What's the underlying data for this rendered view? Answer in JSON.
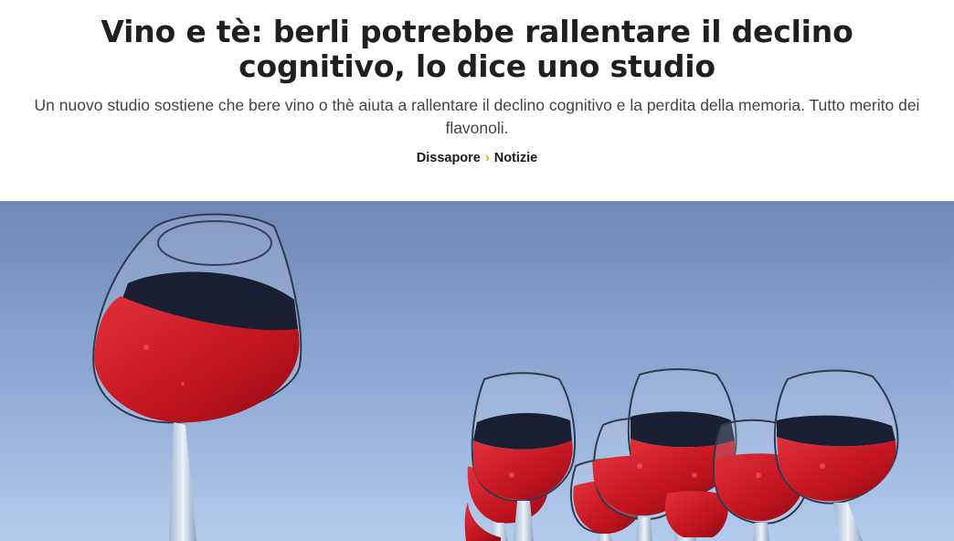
{
  "article": {
    "title": "Vino e tè: berli potrebbe rallentare il declino cognitivo, lo dice uno studio",
    "subtitle": "Un nuovo studio sostiene che bere vino o thè aiuta a rallentare il declino cognitivo e la perdita della memoria. Tutto merito dei flavonoli."
  },
  "breadcrumb": {
    "items": [
      {
        "label": "Dissapore"
      },
      {
        "label": "Notizie"
      }
    ],
    "separator": "›",
    "separator_color": "#f0a81e"
  },
  "hero_image": {
    "subject": "red wine glasses against blue sky",
    "sky_top_color": "#6e8ab6",
    "sky_bottom_color": "#a9c2e6",
    "wine_color": "#c8182a"
  }
}
